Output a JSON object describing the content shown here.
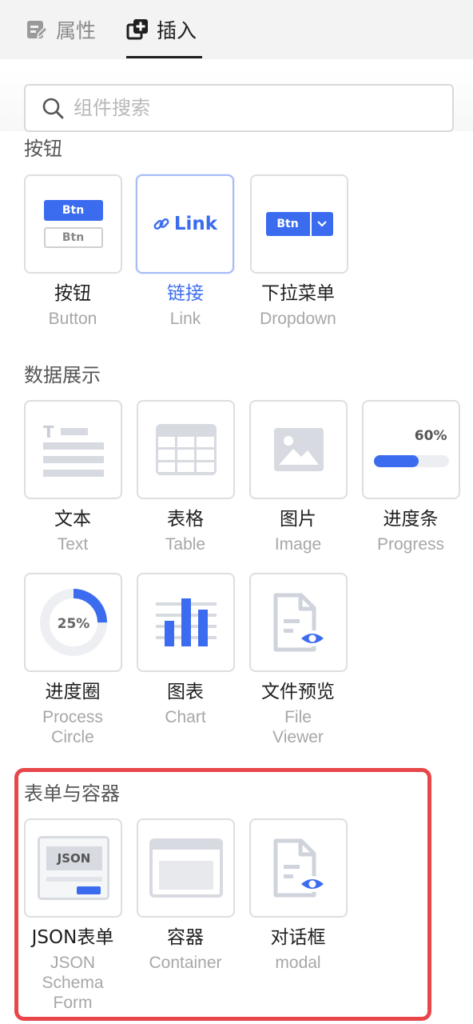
{
  "tabs": [
    {
      "label": "属性",
      "icon": "edit-icon"
    },
    {
      "label": "插入",
      "icon": "add-layer-icon"
    }
  ],
  "search": {
    "placeholder": "组件搜索"
  },
  "sections": [
    {
      "title": "按钮",
      "items": [
        {
          "label": "按钮",
          "sublabel": "Button",
          "preview": {
            "primary_text": "Btn",
            "secondary_text": "Btn"
          }
        },
        {
          "label": "链接",
          "sublabel": "Link",
          "preview": {
            "text": "Link"
          },
          "selected": true
        },
        {
          "label": "下拉菜单",
          "sublabel": "Dropdown",
          "preview": {
            "text": "Btn"
          }
        }
      ]
    },
    {
      "title": "数据展示",
      "items": [
        {
          "label": "文本",
          "sublabel": "Text",
          "preview": {
            "glyph": "T"
          }
        },
        {
          "label": "表格",
          "sublabel": "Table"
        },
        {
          "label": "图片",
          "sublabel": "Image"
        },
        {
          "label": "进度条",
          "sublabel": "Progress",
          "preview": {
            "percent_text": "60%",
            "percent": 0.6
          }
        },
        {
          "label": "进度圈",
          "sublabel": "Process Circle",
          "sublabel_lines": [
            "Process",
            "Circle"
          ],
          "preview": {
            "percent_text": "25%",
            "percent": 0.25
          }
        },
        {
          "label": "图表",
          "sublabel": "Chart"
        },
        {
          "label": "文件预览",
          "sublabel": "File Viewer",
          "sublabel_lines": [
            "File",
            "Viewer"
          ]
        }
      ]
    },
    {
      "title": "表单与容器",
      "items": [
        {
          "label": "JSON表单",
          "sublabel": "JSON Schema Form",
          "sublabel_lines": [
            "JSON",
            "Schema",
            "Form"
          ],
          "preview": {
            "text": "JSON"
          }
        },
        {
          "label": "容器",
          "sublabel": "Container"
        },
        {
          "label": "对话框",
          "sublabel": "modal"
        }
      ]
    }
  ],
  "colors": {
    "accent": "#3b6cf0",
    "highlight": "#e8474a",
    "icon_gray": "#cfd3db"
  }
}
